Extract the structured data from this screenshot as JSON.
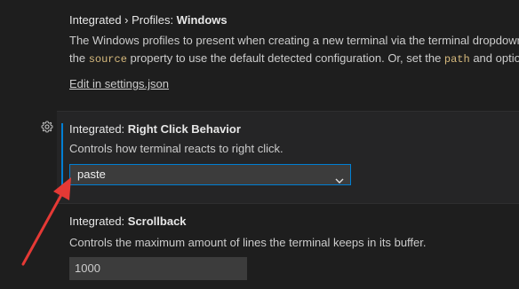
{
  "profiles": {
    "category": "Integrated › Profiles: ",
    "name": "Windows",
    "desc_line1": "The Windows profiles to present when creating a new terminal via the terminal dropdown",
    "desc_line2_a": "the ",
    "desc_code1": "source",
    "desc_line2_b": " property to use the default detected configuration. Or, set the ",
    "desc_code2": "path",
    "desc_line2_c": " and optio",
    "edit_link": "Edit in settings.json"
  },
  "right_click": {
    "category": "Integrated: ",
    "name": "Right Click Behavior",
    "desc": "Controls how terminal reacts to right click.",
    "selected": "paste"
  },
  "scrollback": {
    "category": "Integrated: ",
    "name": "Scrollback",
    "desc": "Controls the maximum amount of lines the terminal keeps in its buffer.",
    "value": "1000"
  },
  "colors": {
    "accent": "#007fd4",
    "annotation_arrow": "#e53935",
    "code": "#d7ba7d"
  }
}
